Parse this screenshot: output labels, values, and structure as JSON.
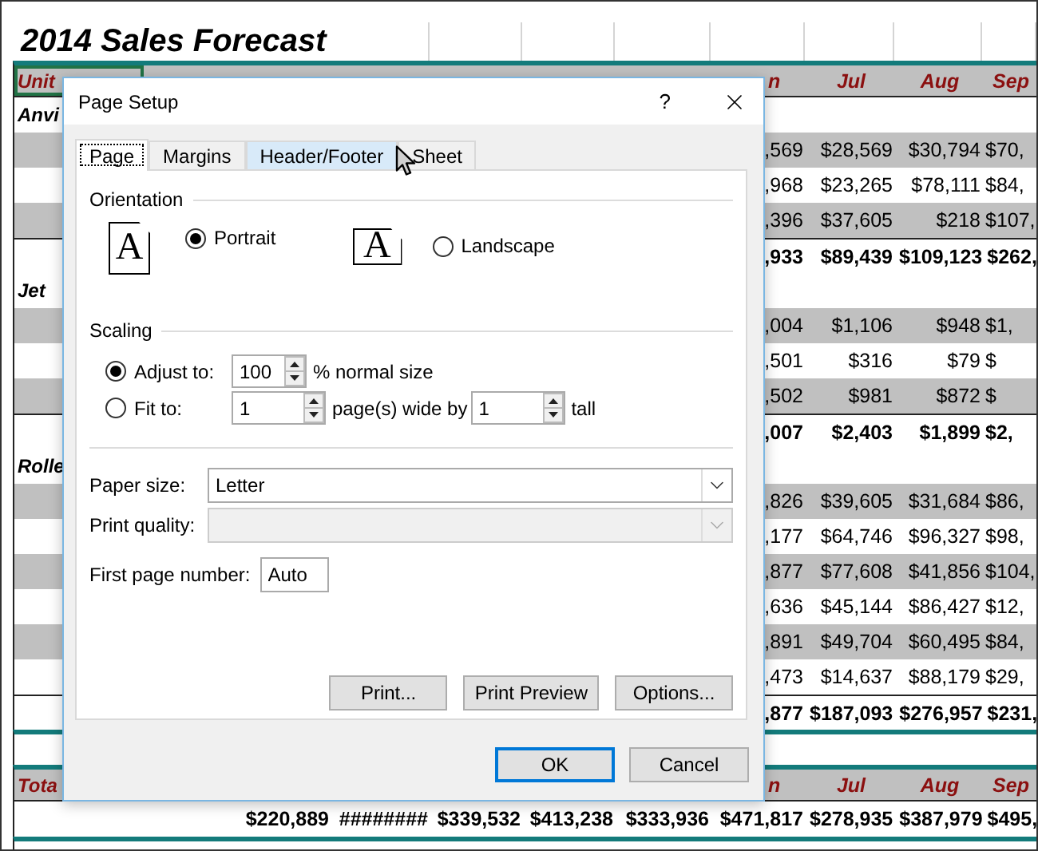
{
  "sheet": {
    "title": "2014 Sales Forecast",
    "rows": [
      {
        "kind": "header",
        "label": "Unit",
        "label_selected": true,
        "cells": [
          "n",
          "Jul",
          "Aug",
          "Sep"
        ]
      },
      {
        "kind": "section",
        "label": "Anvi"
      },
      {
        "kind": "data",
        "shaded": true,
        "cells": [
          ",569",
          "$28,569",
          "$30,794",
          "$70,"
        ]
      },
      {
        "kind": "data",
        "shaded": false,
        "cells": [
          ",968",
          "$23,265",
          "$78,111",
          "$84,"
        ]
      },
      {
        "kind": "data",
        "shaded": true,
        "cells": [
          ",396",
          "$37,605",
          "$218",
          "$107,"
        ]
      },
      {
        "kind": "total",
        "cells": [
          ",933",
          "$89,439",
          "$109,123",
          "$262,"
        ]
      },
      {
        "kind": "section",
        "label": "Jet"
      },
      {
        "kind": "data",
        "shaded": true,
        "cells": [
          ",004",
          "$1,106",
          "$948",
          "$1,"
        ]
      },
      {
        "kind": "data",
        "shaded": false,
        "cells": [
          ",501",
          "$316",
          "$79",
          "$"
        ]
      },
      {
        "kind": "data",
        "shaded": true,
        "cells": [
          ",502",
          "$981",
          "$872",
          "$"
        ]
      },
      {
        "kind": "total",
        "cells": [
          ",007",
          "$2,403",
          "$1,899",
          "$2,"
        ]
      },
      {
        "kind": "section",
        "label": "Rolle"
      },
      {
        "kind": "data",
        "shaded": true,
        "cells": [
          ",826",
          "$39,605",
          "$31,684",
          "$86,"
        ]
      },
      {
        "kind": "data",
        "shaded": false,
        "cells": [
          ",177",
          "$64,746",
          "$96,327",
          "$98,"
        ]
      },
      {
        "kind": "data",
        "shaded": true,
        "cells": [
          ",877",
          "$77,608",
          "$41,856",
          "$104,"
        ]
      },
      {
        "kind": "data",
        "shaded": false,
        "cells": [
          ",636",
          "$45,144",
          "$86,427",
          "$12,"
        ]
      },
      {
        "kind": "data",
        "shaded": true,
        "cells": [
          ",891",
          "$49,704",
          "$60,495",
          "$84,"
        ]
      },
      {
        "kind": "data",
        "shaded": false,
        "cells": [
          ",473",
          "$14,637",
          "$88,179",
          "$29,"
        ]
      },
      {
        "kind": "total",
        "cells": [
          ",877",
          "$187,093",
          "$276,957",
          "$231,"
        ]
      },
      {
        "kind": "blank"
      },
      {
        "kind": "header",
        "label": "Tota",
        "label_selected": false,
        "cells": [
          "n",
          "Jul",
          "Aug",
          "Sep"
        ]
      },
      {
        "kind": "grand",
        "cells": [
          "$220,889",
          "########",
          "$339,532",
          "$413,238",
          "$333,936",
          "$471,817",
          "$278,935",
          "$387,979",
          "$495,"
        ]
      },
      {
        "kind": "blank"
      }
    ]
  },
  "dialog": {
    "title": "Page Setup",
    "help": "?",
    "tabs": [
      {
        "label": "Page",
        "selected": true,
        "hovered": false
      },
      {
        "label": "Margins",
        "selected": false,
        "hovered": false
      },
      {
        "label": "Header/Footer",
        "selected": false,
        "hovered": true
      },
      {
        "label": "Sheet",
        "selected": false,
        "hovered": false
      }
    ],
    "orientation": {
      "heading": "Orientation",
      "options": [
        {
          "kind": "portrait",
          "glyph": "A",
          "label": "Portrait",
          "selected": true
        },
        {
          "kind": "landscape",
          "glyph": "A",
          "label": "Landscape",
          "selected": false
        }
      ]
    },
    "scaling": {
      "heading": "Scaling",
      "options": [
        {
          "label": "Adjust to:",
          "selected": true,
          "parts": [
            {
              "kind": "spin",
              "value": "100"
            },
            {
              "kind": "text",
              "text": "% normal size"
            }
          ]
        },
        {
          "label": "Fit to:",
          "selected": false,
          "parts": [
            {
              "kind": "spin",
              "value": "1"
            },
            {
              "kind": "text",
              "text": "page(s) wide by"
            },
            {
              "kind": "spin",
              "value": "1"
            },
            {
              "kind": "text",
              "text": "tall"
            }
          ]
        }
      ]
    },
    "fields": [
      {
        "kind": "select",
        "label": "Paper size:",
        "value": "Letter",
        "disabled": false
      },
      {
        "kind": "select",
        "label": "Print quality:",
        "disabled": true
      },
      {
        "kind": "text",
        "label": "First page number:",
        "value": "Auto"
      }
    ],
    "panel_buttons": [
      "Print...",
      "Print Preview",
      "Options..."
    ],
    "buttons": [
      {
        "label": "OK",
        "default": true
      },
      {
        "label": "Cancel",
        "default": false
      }
    ]
  }
}
